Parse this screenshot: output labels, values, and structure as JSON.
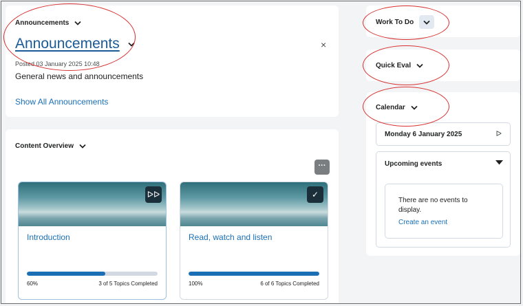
{
  "announcements": {
    "widget_title": "Announcements",
    "item_title": "Announcements",
    "posted": "Posted 03 January 2025 10:48",
    "body": "General news and announcements",
    "show_all": "Show All Announcements",
    "close_symbol": "×"
  },
  "content_overview": {
    "widget_title": "Content Overview",
    "more_symbol": "···",
    "courses": [
      {
        "title": "Introduction",
        "progress_percent": 60,
        "percent_label": "60%",
        "topics_label": "3 of 5 Topics Completed",
        "badge_icon": "fast-forward-icon",
        "badge_symbol": "ᐅᐅ"
      },
      {
        "title": "Read, watch and listen",
        "progress_percent": 100,
        "percent_label": "100%",
        "topics_label": "6 of 6 Topics Completed",
        "badge_icon": "check-icon",
        "badge_symbol": "✓"
      }
    ]
  },
  "work_to_do": {
    "title": "Work To Do"
  },
  "quick_eval": {
    "title": "Quick Eval"
  },
  "calendar": {
    "title": "Calendar",
    "date": "Monday 6 January 2025",
    "next_symbol": "ᐅ",
    "upcoming_label": "Upcoming events",
    "no_events": "There are no events to display.",
    "create_event": "Create an event"
  },
  "colors": {
    "link": "#1a6fb5",
    "annotation_red": "#d93030",
    "progress_fill": "#1a6fb5",
    "progress_track": "#d3d9e3"
  }
}
